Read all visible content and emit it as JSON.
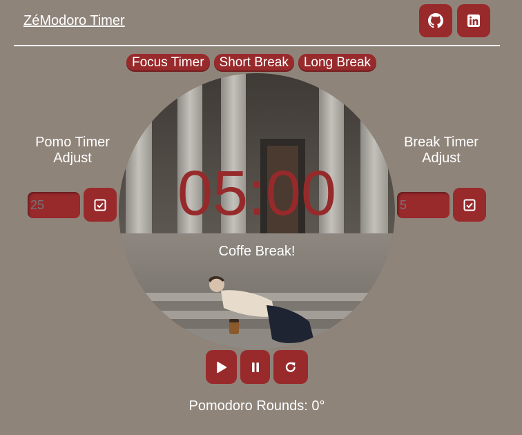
{
  "header": {
    "title": "ZéModoro Timer",
    "github_icon": "github-icon",
    "linkedin_icon": "linkedin-icon"
  },
  "tabs": [
    {
      "label": "Focus Timer"
    },
    {
      "label": "Short Break"
    },
    {
      "label": "Long Break"
    }
  ],
  "timer": {
    "display": "05:00",
    "message": "Coffe Break!"
  },
  "pomo_adjust": {
    "label_line1": "Pomo Timer",
    "label_line2": "Adjust",
    "value": "25",
    "confirm_icon": "check-square-icon"
  },
  "break_adjust": {
    "label_line1": "Break Timer",
    "label_line2": "Adjust",
    "value": "5",
    "confirm_icon": "check-square-icon"
  },
  "controls": {
    "play_icon": "play-icon",
    "pause_icon": "pause-icon",
    "reset_icon": "reset-icon"
  },
  "rounds": {
    "text": "Pomodoro Rounds: 0°"
  },
  "colors": {
    "background": "#8f847a",
    "accent": "#992a2c",
    "timer_text": "#962a2b",
    "text": "#ffffff"
  }
}
